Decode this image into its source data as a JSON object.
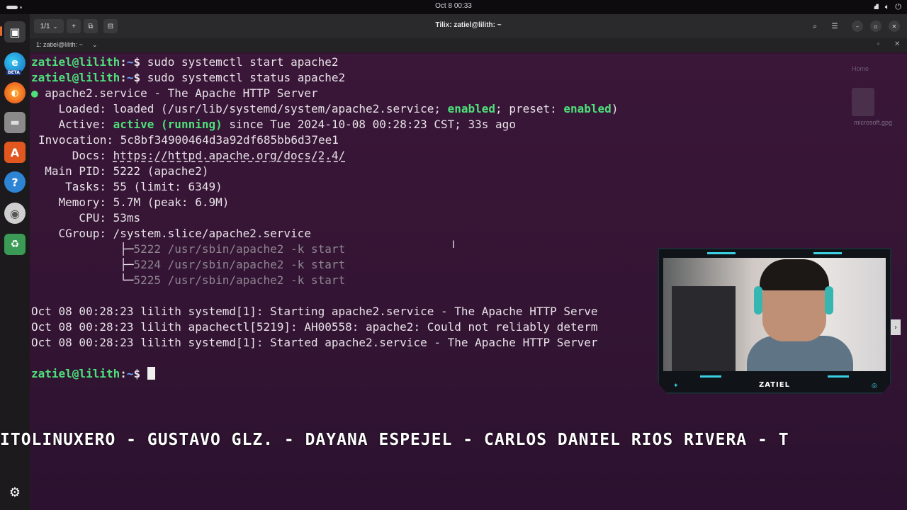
{
  "topbar": {
    "clock": "Oct 8  00:33",
    "tray": {
      "network_icon": "network-icon",
      "volume_icon": "volume-icon",
      "power_icon": "power-icon"
    }
  },
  "dock": {
    "items": [
      {
        "name": "tilix",
        "icon": "terminal-icon",
        "glyph": "▣",
        "color": "#3a3a3d"
      },
      {
        "name": "edge-beta",
        "icon": "edge-icon",
        "glyph": "e",
        "color": "#1a8fd6"
      },
      {
        "name": "firefox",
        "icon": "firefox-icon",
        "glyph": "●",
        "color": "#e5601e"
      },
      {
        "name": "files",
        "icon": "files-icon",
        "glyph": "▬",
        "color": "#8f8f8f"
      },
      {
        "name": "app-center",
        "icon": "app-store-icon",
        "glyph": "A",
        "color": "#e2571f"
      },
      {
        "name": "help",
        "icon": "help-icon",
        "glyph": "?",
        "color": "#2e84d4"
      },
      {
        "name": "disc",
        "icon": "disc-icon",
        "glyph": "◉",
        "color": "#c8c8c8"
      },
      {
        "name": "trash",
        "icon": "trash-icon",
        "glyph": "♻",
        "color": "#3b9a55"
      },
      {
        "name": "show-apps",
        "icon": "ubuntu-logo-icon",
        "glyph": "⚙",
        "color": "#1d1a1e"
      }
    ],
    "edge_badge": "BETA"
  },
  "window": {
    "title": "Tilix: zatiel@lilith: ~",
    "session_counter": "1/1",
    "session_label": "1: zatiel@lilith: ~",
    "controls": {
      "minimize": "–",
      "maximize": "▫",
      "close": "✕"
    }
  },
  "desktop": {
    "home_label": "Home",
    "file_label": "microsoft.gpg"
  },
  "terminal": {
    "prompt_user": "zatiel@lilith",
    "prompt_path": "~",
    "prompt_symbol": "$",
    "cmd1": " sudo systemctl start apache2",
    "cmd2": " sudo systemctl status apache2",
    "service_header": "apache2.service - The Apache HTTP Server",
    "loaded_key": "    Loaded:",
    "loaded_value_a": " loaded (/usr/lib/systemd/system/apache2.service; ",
    "loaded_enabled": "enabled",
    "loaded_value_b": "; preset: ",
    "loaded_preset": "enabled",
    "loaded_value_c": ")",
    "active_key": "    Active:",
    "active_state": "active (running)",
    "active_since": " since Tue 2024-10-08 00:28:23 CST; 33s ago",
    "invocation": "Invocation: 5c8bf34900464d3a92df685bb6d37ee1",
    "docs_key": "      Docs: ",
    "docs_url": "https://httpd.apache.org/docs/2.4/",
    "main_pid": "  Main PID: 5222 (apache2)",
    "tasks": "     Tasks: 55 (limit: 6349)",
    "memory": "    Memory: 5.7M (peak: 6.9M)",
    "cpu": "       CPU: 53ms",
    "cgroup": "    CGroup: /system.slice/apache2.service",
    "proc1_tree": "             ├─",
    "proc1": "5222 /usr/sbin/apache2 -k start",
    "proc2_tree": "             ├─",
    "proc2": "5224 /usr/sbin/apache2 -k start",
    "proc3_tree": "             └─",
    "proc3": "5225 /usr/sbin/apache2 -k start",
    "log1": "Oct 08 00:28:23 lilith systemd[1]: Starting apache2.service - The Apache HTTP Serve",
    "log2": "Oct 08 00:28:23 lilith apachectl[5219]: AH00558: apache2: Could not reliably determ",
    "log3": "Oct 08 00:28:23 lilith systemd[1]: Started apache2.service - The Apache HTTP Server"
  },
  "ticker": {
    "text": "ITOLINUXERO - GUSTAVO GLZ. - DAYANA ESPEJEL - CARLOS DANIEL RIOS RIVERA - T"
  },
  "webcam": {
    "brand": "ZATIEL"
  },
  "colors": {
    "terminal_bg": "#331433",
    "prompt_green": "#4ee07a",
    "path_blue": "#6aa7ff",
    "accent_cyan": "#3ad1e4"
  }
}
